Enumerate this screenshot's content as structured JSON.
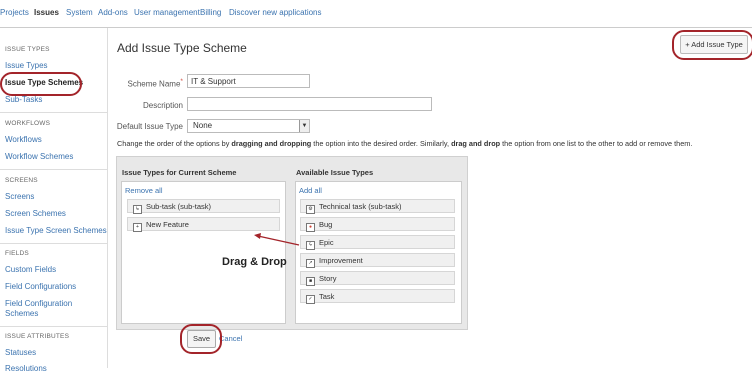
{
  "topnav": {
    "tabs": [
      {
        "label": "Projects",
        "active": false
      },
      {
        "label": "Issues",
        "active": true
      },
      {
        "label": "System",
        "active": false
      },
      {
        "label": "Add-ons",
        "active": false
      },
      {
        "label": "User management",
        "active": false
      },
      {
        "label": "Billing",
        "active": false
      },
      {
        "label": "Discover new applications",
        "active": false
      }
    ]
  },
  "sidebar": {
    "sections": [
      {
        "heading": "ISSUE TYPES",
        "items": [
          "Issue Types",
          "Issue Type Schemes",
          "Sub-Tasks"
        ]
      },
      {
        "heading": "WORKFLOWS",
        "items": [
          "Workflows",
          "Workflow Schemes"
        ]
      },
      {
        "heading": "SCREENS",
        "items": [
          "Screens",
          "Screen Schemes",
          "Issue Type Screen Schemes"
        ]
      },
      {
        "heading": "FIELDS",
        "items": [
          "Custom Fields",
          "Field Configurations",
          "Field Configuration Schemes"
        ]
      },
      {
        "heading": "ISSUE ATTRIBUTES",
        "items": [
          "Statuses",
          "Resolutions"
        ]
      }
    ],
    "active_item": "Issue Type Schemes"
  },
  "page": {
    "title": "Add Issue Type Scheme",
    "add_issue_type_label": "+ Add Issue Type"
  },
  "form": {
    "scheme_name_label": "Scheme Name",
    "required_mark": "*",
    "scheme_name_value": "IT & Support",
    "description_label": "Description",
    "description_value": "",
    "default_issue_type_label": "Default Issue Type",
    "default_issue_type_value": "None"
  },
  "instructions": {
    "part1": "Change the order of the options by ",
    "bold1": "dragging and dropping",
    "part2": " the option into the desired order. Similarly, ",
    "bold2": "drag and drop",
    "part3": " the option from one list to the other to add or remove them."
  },
  "current_scheme": {
    "heading": "Issue Types for Current Scheme",
    "action": "Remove all",
    "items": [
      {
        "label": "Sub-task (sub-task)",
        "icon": "subtask-icon"
      },
      {
        "label": "New Feature",
        "icon": "new-feature-icon"
      }
    ]
  },
  "available": {
    "heading": "Available Issue Types",
    "action": "Add all",
    "items": [
      {
        "label": "Technical task (sub-task)",
        "icon": "technical-task-icon"
      },
      {
        "label": "Bug",
        "icon": "bug-icon",
        "color": "#d04437"
      },
      {
        "label": "Epic",
        "icon": "epic-icon"
      },
      {
        "label": "Improvement",
        "icon": "improvement-icon"
      },
      {
        "label": "Story",
        "icon": "story-icon"
      },
      {
        "label": "Task",
        "icon": "task-icon"
      }
    ]
  },
  "annotation": {
    "drag_drop": "Drag & Drop"
  },
  "buttons": {
    "save": "Save",
    "cancel": "Cancel"
  },
  "colors": {
    "highlight_ring": "#a3242a",
    "link": "#3b73af"
  }
}
